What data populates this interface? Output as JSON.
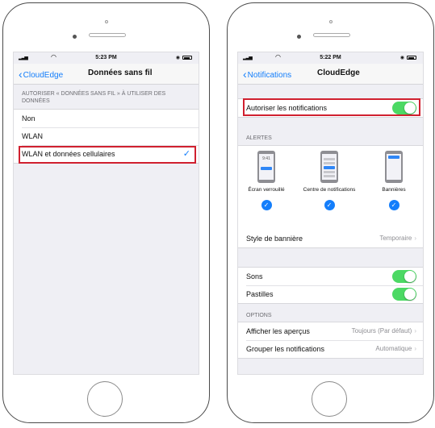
{
  "left": {
    "status": {
      "time": "5:23 PM"
    },
    "nav": {
      "back": "CloudEdge",
      "title": "Données sans fil"
    },
    "section_header": "AUTORISER « DONNÉES SANS FIL » À UTILISER DES DONNÉES",
    "options": [
      {
        "label": "Non",
        "selected": false
      },
      {
        "label": "WLAN",
        "selected": false
      },
      {
        "label": "WLAN et données cellulaires",
        "selected": true
      }
    ]
  },
  "right": {
    "status": {
      "time": "5:22 PM"
    },
    "nav": {
      "back": "Notifications",
      "title": "CloudEdge"
    },
    "allow_notifications": {
      "label": "Autoriser les notifications",
      "on": true
    },
    "alerts_header": "ALERTES",
    "alert_styles": [
      {
        "label": "Écran verrouillé",
        "preview_time": "9:41",
        "checked": true
      },
      {
        "label": "Centre de notifications",
        "checked": true
      },
      {
        "label": "Bannières",
        "checked": true
      }
    ],
    "banner_style": {
      "label": "Style de bannière",
      "value": "Temporaire"
    },
    "sounds": {
      "label": "Sons",
      "on": true
    },
    "badges": {
      "label": "Pastilles",
      "on": true
    },
    "options_header": "OPTIONS",
    "show_previews": {
      "label": "Afficher les aperçus",
      "value": "Toujours (Par défaut)"
    },
    "grouping": {
      "label": "Grouper les notifications",
      "value": "Automatique"
    }
  },
  "colors": {
    "accent": "#147efb",
    "toggle_on": "#4cd964",
    "highlight": "#d0202f"
  }
}
